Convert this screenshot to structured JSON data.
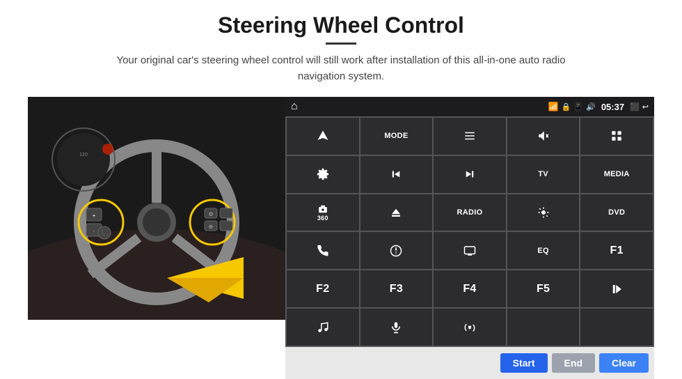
{
  "header": {
    "title": "Steering Wheel Control",
    "divider": true,
    "subtitle": "Your original car's steering wheel control will still work after installation of this all-in-one auto radio navigation system."
  },
  "status_bar": {
    "time": "05:37",
    "icons": [
      "wifi",
      "lock",
      "sim",
      "bluetooth",
      "battery",
      "cast",
      "back"
    ]
  },
  "button_grid": [
    {
      "id": "nav",
      "label": "",
      "icon": "navigation"
    },
    {
      "id": "mode",
      "label": "MODE",
      "icon": ""
    },
    {
      "id": "list",
      "label": "",
      "icon": "list"
    },
    {
      "id": "mute",
      "label": "",
      "icon": "mute"
    },
    {
      "id": "apps",
      "label": "",
      "icon": "apps"
    },
    {
      "id": "settings",
      "label": "",
      "icon": "settings"
    },
    {
      "id": "prev",
      "label": "",
      "icon": "prev"
    },
    {
      "id": "next",
      "label": "",
      "icon": "next"
    },
    {
      "id": "tv",
      "label": "TV",
      "icon": ""
    },
    {
      "id": "media",
      "label": "MEDIA",
      "icon": ""
    },
    {
      "id": "360cam",
      "label": "360",
      "icon": "car"
    },
    {
      "id": "eject",
      "label": "",
      "icon": "eject"
    },
    {
      "id": "radio",
      "label": "RADIO",
      "icon": ""
    },
    {
      "id": "bright",
      "label": "",
      "icon": "brightness"
    },
    {
      "id": "dvd",
      "label": "DVD",
      "icon": ""
    },
    {
      "id": "phone",
      "label": "",
      "icon": "phone"
    },
    {
      "id": "nav2",
      "label": "",
      "icon": "compass"
    },
    {
      "id": "screen",
      "label": "",
      "icon": "screen"
    },
    {
      "id": "eq",
      "label": "EQ",
      "icon": ""
    },
    {
      "id": "f1",
      "label": "F1",
      "icon": ""
    },
    {
      "id": "f2",
      "label": "F2",
      "icon": ""
    },
    {
      "id": "f3",
      "label": "F3",
      "icon": ""
    },
    {
      "id": "f4",
      "label": "F4",
      "icon": ""
    },
    {
      "id": "f5",
      "label": "F5",
      "icon": ""
    },
    {
      "id": "playpause",
      "label": "",
      "icon": "playpause"
    },
    {
      "id": "music",
      "label": "",
      "icon": "music"
    },
    {
      "id": "mic",
      "label": "",
      "icon": "mic"
    },
    {
      "id": "hangup",
      "label": "",
      "icon": "hangup"
    },
    {
      "id": "empty1",
      "label": "",
      "icon": ""
    },
    {
      "id": "empty2",
      "label": "",
      "icon": ""
    }
  ],
  "action_bar": {
    "start_label": "Start",
    "end_label": "End",
    "clear_label": "Clear"
  }
}
